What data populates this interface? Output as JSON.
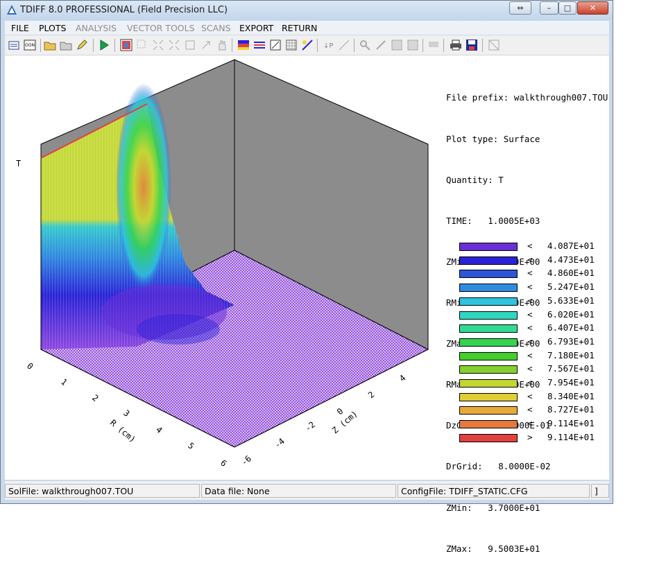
{
  "window": {
    "title": "TDIFF 8.0 PROFESSIONAL (Field Precision LLC)",
    "buttons": {
      "swap": "⇔",
      "minimize": "–",
      "maximize": "□",
      "close": "✕"
    }
  },
  "menu": [
    "FILE",
    "PLOTS",
    "ANALYSIS",
    "VECTOR TOOLS",
    "SCANS",
    "EXPORT",
    "RETURN"
  ],
  "menu_disabled": [
    "ANALYSIS",
    "VECTOR TOOLS",
    "SCANS"
  ],
  "plot": {
    "info_lines": [
      "File prefix: walkthrough007.TOU",
      "Plot type: Surface",
      "Quantity: T",
      "TIME:   1.0005E+03",
      "ZMin:  -6.0000E+00",
      "RMin:   0.0000E+00",
      "ZMax:   6.0000E+00",
      "RMax:   6.0000E+00",
      "DzGrid:   1.6000E-01",
      "DrGrid:   8.0000E-02",
      "ZMin:   3.7000E+01",
      "ZMax:   9.5003E+01"
    ],
    "y_axis_label": "T",
    "r_axis_label": "R (cm)",
    "z_axis_label": "Z (cm)",
    "r_ticks": [
      "0",
      "1",
      "2",
      "3",
      "4",
      "5",
      "6"
    ],
    "z_ticks": [
      "-6",
      "-4",
      "-2",
      "0",
      "2",
      "4"
    ],
    "legend": [
      {
        "op": "<",
        "value": "4.087E+01",
        "color": "#6a2fd8"
      },
      {
        "op": "<",
        "value": "4.473E+01",
        "color": "#2a23d6"
      },
      {
        "op": "<",
        "value": "4.860E+01",
        "color": "#2d56d6"
      },
      {
        "op": "<",
        "value": "5.247E+01",
        "color": "#2f8ae0"
      },
      {
        "op": "<",
        "value": "5.633E+01",
        "color": "#2fc3e0"
      },
      {
        "op": "<",
        "value": "6.020E+01",
        "color": "#2fd7c0"
      },
      {
        "op": "<",
        "value": "6.407E+01",
        "color": "#31db95"
      },
      {
        "op": "<",
        "value": "6.793E+01",
        "color": "#33d44f"
      },
      {
        "op": "<",
        "value": "7.180E+01",
        "color": "#43d02c"
      },
      {
        "op": "<",
        "value": "7.567E+01",
        "color": "#86d02f"
      },
      {
        "op": "<",
        "value": "7.954E+01",
        "color": "#c3d631"
      },
      {
        "op": "<",
        "value": "8.340E+01",
        "color": "#dfcf35"
      },
      {
        "op": "<",
        "value": "8.727E+01",
        "color": "#e7aa3a"
      },
      {
        "op": "<",
        "value": "9.114E+01",
        "color": "#e57a40"
      },
      {
        "op": ">",
        "value": "9.114E+01",
        "color": "#e04141"
      }
    ]
  },
  "status": {
    "solfile": "SolFile: walkthrough007.TOU",
    "datafile": "Data file: None",
    "configfile": "ConfigFile: TDIFF_STATIC.CFG",
    "extra": "]"
  }
}
